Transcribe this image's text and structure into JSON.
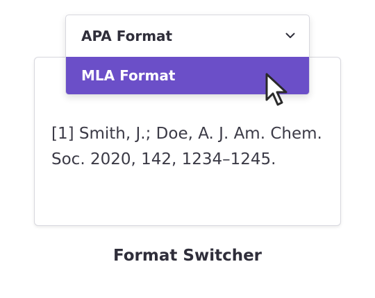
{
  "dropdown": {
    "selected_label": "APA Format",
    "options": [
      {
        "label": "MLA Format",
        "state": "hovered"
      }
    ]
  },
  "citation": {
    "text": "[1] Smith, J.; Doe, A. J. Am. Chem. Soc. 2020, 142, 1234–1245."
  },
  "caption": "Format Switcher",
  "colors": {
    "accent": "#6b4fc8",
    "text": "#2f2e3a",
    "border": "#d7d7de"
  },
  "icons": {
    "chevron": "chevron-down-icon",
    "cursor": "mouse-pointer-icon"
  }
}
